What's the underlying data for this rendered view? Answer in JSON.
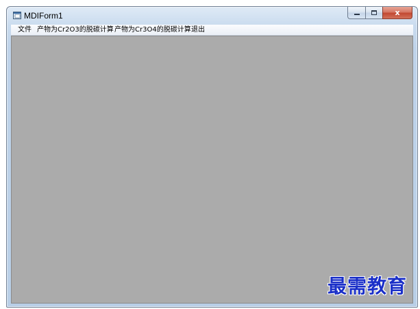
{
  "window": {
    "title": "MDIForm1",
    "icon": "form-window-icon",
    "controls": {
      "minimize_icon": "minimize-icon",
      "maximize_icon": "maximize-icon",
      "close_label": "x"
    }
  },
  "menubar": {
    "items": [
      {
        "label": "文件"
      },
      {
        "label": "产物为Cr2O3的脱碳计算"
      },
      {
        "label": "产物为Cr3O4的脱碳计算"
      },
      {
        "label": "退出"
      }
    ]
  },
  "client_area": {
    "background": "#ababab"
  },
  "watermark": {
    "text": "最需教育",
    "color": "#1a2fc8"
  }
}
